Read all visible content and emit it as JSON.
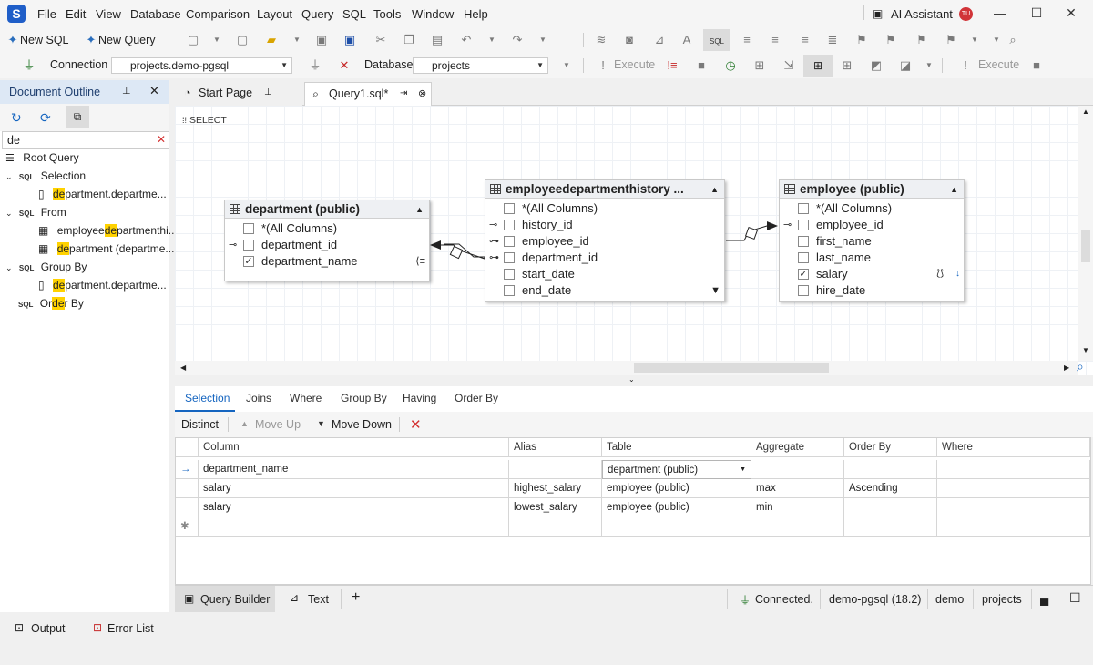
{
  "menubar": {
    "items": [
      "File",
      "Edit",
      "View",
      "Database",
      "Comparison",
      "Layout",
      "Query",
      "SQL",
      "Tools",
      "Window",
      "Help"
    ],
    "ai_assistant": "AI Assistant",
    "user_initials": "TU"
  },
  "toolbar1": {
    "new_sql": "New SQL",
    "new_query": "New Query"
  },
  "toolbar2": {
    "connection_label": "Connection",
    "connection_value": "projects.demo-pgsql",
    "database_label": "Database",
    "database_value": "projects",
    "execute_label": "Execute",
    "execute2_label": "Execute"
  },
  "outline": {
    "title": "Document Outline",
    "search_value": "de",
    "root": "Root Query",
    "sections": [
      {
        "tag": "SQL",
        "label": "Selection"
      },
      {
        "tag": "SQL",
        "label": "From"
      },
      {
        "tag": "SQL",
        "label": "Group By"
      },
      {
        "tag": "SQL",
        "label": "Order By"
      }
    ],
    "selection_item": {
      "pre": "",
      "hl": "de",
      "post": "partment.departme..."
    },
    "from_items": [
      {
        "pre": "employee",
        "hl": "de",
        "post": "partmenthi..."
      },
      {
        "pre": "",
        "hl": "de",
        "post": "partment (departme..."
      }
    ],
    "groupby_item": {
      "pre": "",
      "hl": "de",
      "post": "partment.departme..."
    },
    "orderby_parts": {
      "pre": "Or",
      "hl": "de",
      "post": "r By"
    }
  },
  "tabs": {
    "start_page": "Start Page",
    "query1": "Query1.sql*"
  },
  "diagram": {
    "select_label": "SELECT",
    "department": {
      "title": "department (public)",
      "columns": [
        {
          "name": "*(All Columns)",
          "checked": false,
          "key": ""
        },
        {
          "name": "department_id",
          "checked": false,
          "key": "pk"
        },
        {
          "name": "department_name",
          "checked": true,
          "key": ""
        }
      ]
    },
    "edh": {
      "title": "employeedepartmenthistory ...",
      "columns": [
        {
          "name": "*(All Columns)",
          "checked": false,
          "key": ""
        },
        {
          "name": "history_id",
          "checked": false,
          "key": "pk"
        },
        {
          "name": "employee_id",
          "checked": false,
          "key": "fk"
        },
        {
          "name": "department_id",
          "checked": false,
          "key": "fk"
        },
        {
          "name": "start_date",
          "checked": false,
          "key": ""
        },
        {
          "name": "end_date",
          "checked": false,
          "key": ""
        }
      ]
    },
    "employee": {
      "title": "employee (public)",
      "columns": [
        {
          "name": "*(All Columns)",
          "checked": false,
          "key": ""
        },
        {
          "name": "employee_id",
          "checked": false,
          "key": "pk"
        },
        {
          "name": "first_name",
          "checked": false,
          "key": ""
        },
        {
          "name": "last_name",
          "checked": false,
          "key": ""
        },
        {
          "name": "salary",
          "checked": true,
          "key": ""
        },
        {
          "name": "hire_date",
          "checked": false,
          "key": ""
        }
      ]
    }
  },
  "query_tabs": [
    "Selection",
    "Joins",
    "Where",
    "Group By",
    "Having",
    "Order By"
  ],
  "query_toolbar": {
    "distinct": "Distinct",
    "move_up": "Move Up",
    "move_down": "Move Down"
  },
  "grid": {
    "headers": [
      "Column",
      "Alias",
      "Table",
      "Aggregate",
      "Order By",
      "Where"
    ],
    "rows": [
      [
        "department_name",
        "",
        "department (public)",
        "",
        "",
        ""
      ],
      [
        "salary",
        "highest_salary",
        "employee (public)",
        "max",
        "Ascending",
        ""
      ],
      [
        "salary",
        "lowest_salary",
        "employee (public)",
        "min",
        "",
        ""
      ]
    ]
  },
  "editor_status": {
    "query_builder": "Query Builder",
    "text": "Text",
    "connected": "Connected.",
    "server": "demo-pgsql (18.2)",
    "user": "demo",
    "database": "projects"
  },
  "bottom_panel": {
    "output": "Output",
    "error_list": "Error List"
  }
}
